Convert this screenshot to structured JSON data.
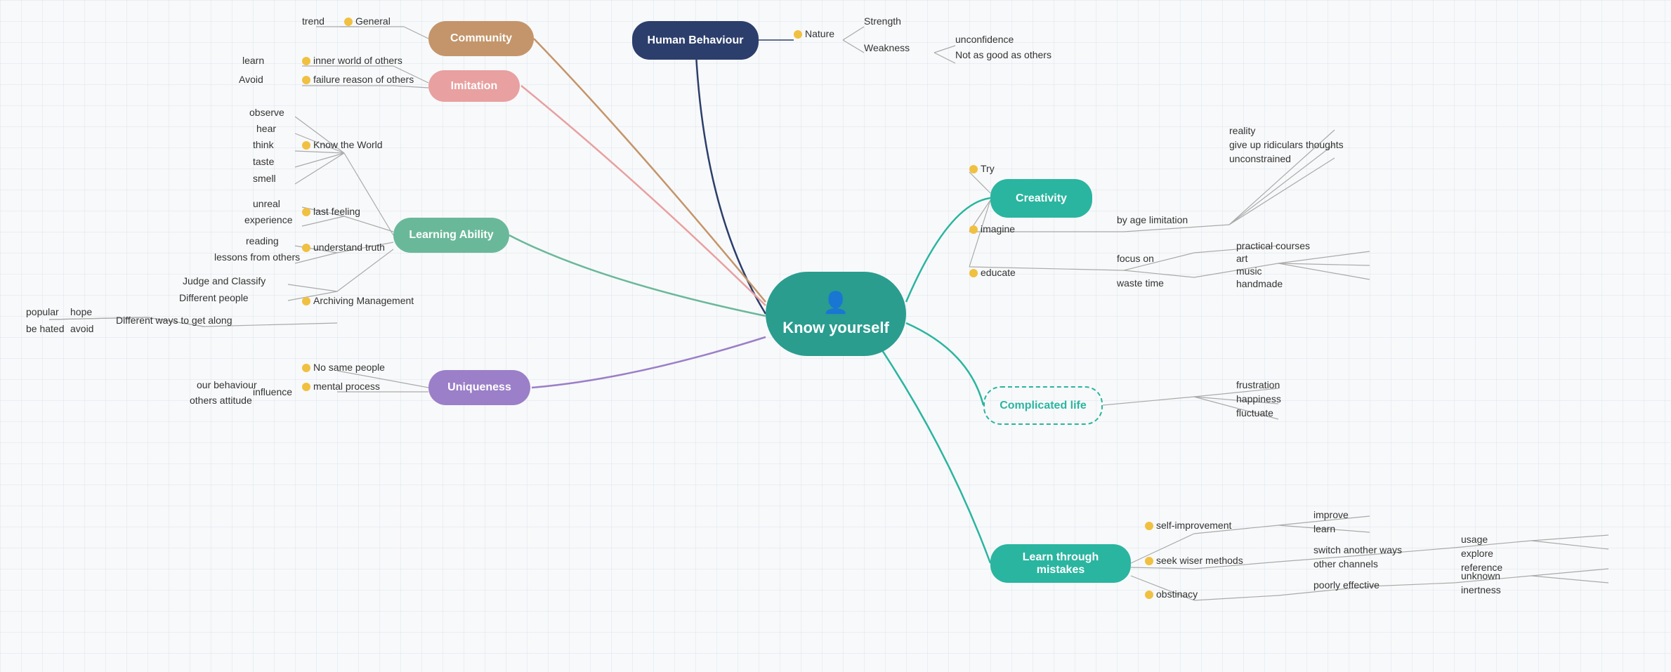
{
  "title": "Know yourself",
  "center": {
    "label": "Know yourself",
    "icon": "👤"
  },
  "nodes": {
    "human_behaviour": "Human Behaviour",
    "community": "Community",
    "imitation": "Imitation",
    "learning_ability": "Learning Ability",
    "uniqueness": "Uniqueness",
    "creativity": "Creativity",
    "complicated_life": "Complicated life",
    "learn_through_mistakes": "Learn through mistakes"
  },
  "labels": {
    "nature": "Nature",
    "strength": "Strength",
    "weakness": "Weakness",
    "unconfidence": "unconfidence",
    "not_as_good": "Not as good as others",
    "trend": "trend",
    "general": "General",
    "learn": "learn",
    "avoid": "Avoid",
    "inner_world": "inner world of others",
    "failure_reason": "failure reason of others",
    "observe": "observe",
    "hear": "hear",
    "think": "think",
    "taste": "taste",
    "smell": "smell",
    "know_the_world": "Know the World",
    "unreal": "unreal",
    "experience": "experience",
    "last_feeling": "last feeling",
    "reading": "reading",
    "lessons_from_others": "lessons from others",
    "understand_truth": "understand truth",
    "judge_classify": "Judge and Classify",
    "different_people": "Different people",
    "archiving_management": "Archiving Management",
    "popular": "popular",
    "hope": "hope",
    "be_hated": "be hated",
    "avoid2": "avoid",
    "different_ways": "Different ways to get along",
    "our_behaviour": "our behaviour",
    "others_attitude": "others attitude",
    "influence": "influence",
    "no_same_people": "No same people",
    "mental_process": "mental process",
    "try": "Try",
    "imagine": "imagine",
    "by_age_limitation": "by age limitation",
    "reality": "reality",
    "give_up_ridiculous": "give up ridiculars thoughts",
    "unconstrained": "unconstrained",
    "educate": "educate",
    "focus_on": "focus on",
    "practical_courses": "practical courses",
    "waste_time": "waste time",
    "art": "art",
    "music": "music",
    "handmade": "handmade",
    "frustration": "frustration",
    "happiness": "happiness",
    "fluctuate": "fluctuate",
    "self_improvement": "self-improvement",
    "improve": "improve",
    "learn2": "learn",
    "seek_wiser": "seek wiser methods",
    "switch_another": "switch another ways",
    "usage": "usage",
    "other_channels": "other channels",
    "explore": "explore",
    "reference": "reference",
    "obstinacy": "obstinacy",
    "poorly_effective": "poorly effective",
    "unknown": "unknown",
    "inertness": "inertness"
  }
}
